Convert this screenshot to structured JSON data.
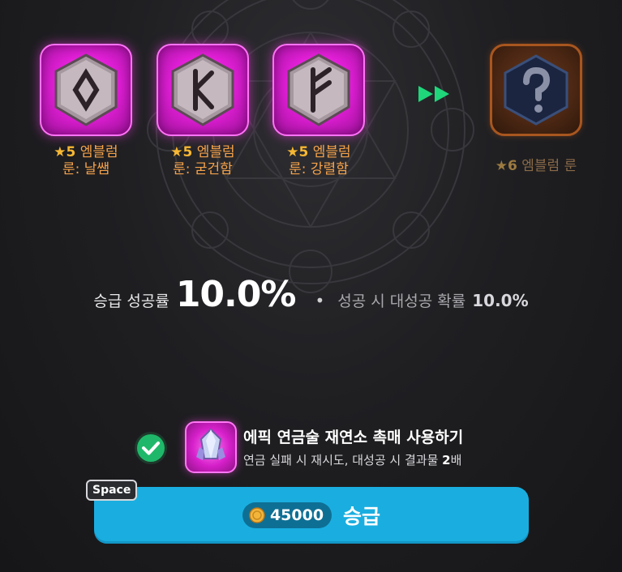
{
  "materials": [
    {
      "grade": "5",
      "name_line1": "엠블럼",
      "name_line2": "룬: 날쌤",
      "rune_glyph": "diamond-rune-icon"
    },
    {
      "grade": "5",
      "name_line1": "엠블럼",
      "name_line2": "룬: 굳건함",
      "rune_glyph": "kaunan-rune-icon"
    },
    {
      "grade": "5",
      "name_line1": "엠블럼",
      "name_line2": "룬: 강렬함",
      "rune_glyph": "fehu-rune-icon"
    }
  ],
  "star_symbol": "★",
  "result": {
    "grade": "6",
    "name": "엠블럼 룬",
    "icon": "question-mark-icon"
  },
  "rate": {
    "label": "승급 성공률",
    "value": "10.0%",
    "separator": "•",
    "great_label": "성공 시 대성공 확률",
    "great_value": "10.0%"
  },
  "catalyst": {
    "title": "에픽 연금술 재연소 촉매 사용하기",
    "desc_prefix": "연금 실패 시 재시도, 대성공 시 결과물",
    "desc_multiplier": "2",
    "desc_suffix": "배",
    "checked": true
  },
  "upgrade_button": {
    "cost": "45000",
    "label": "승급",
    "hotkey": "Space"
  },
  "colors": {
    "accent_pink": "#e21fd7",
    "button_blue": "#1aaee0",
    "grade_gold": "#f7b733",
    "check_green": "#1fb86a"
  }
}
